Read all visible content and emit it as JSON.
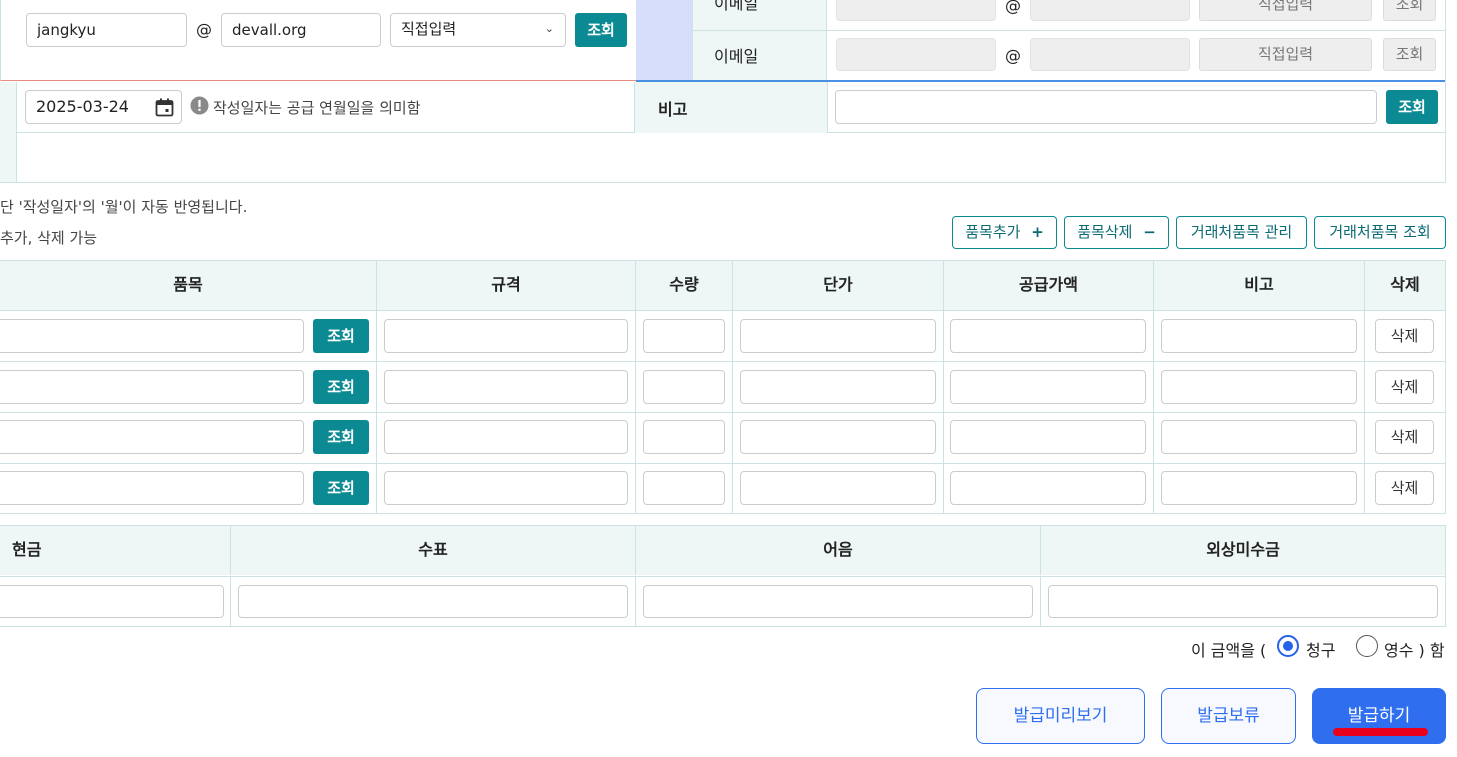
{
  "email_row1": {
    "id": "jangkyu",
    "at": "@",
    "domain": "devall.org",
    "domain_select": "직접입력",
    "lookup": "조회"
  },
  "email_right": {
    "label_top": "이메일",
    "label": "이메일",
    "at": "@",
    "select": "직접입력",
    "lookup": "조회"
  },
  "date_row": {
    "date": "2025-03-24",
    "notice": "작성일자는 공급 연월일을 의미함",
    "remark_label": "비고",
    "remark_value": "",
    "lookup": "조회"
  },
  "notes": {
    "line1": "단 '작성일자'의 '월'이 자동 반영됩니다.",
    "line2": "추가, 삭제 가능"
  },
  "item_actions": {
    "add": "품목추가",
    "remove": "품목삭제",
    "manage": "거래처품목 관리",
    "lookup": "거래처품목 조회"
  },
  "items_table": {
    "headers": [
      "품목",
      "규격",
      "수량",
      "단가",
      "공급가액",
      "비고",
      "삭제"
    ],
    "lookup_label": "조회",
    "delete_label": "삭제",
    "rows": [
      {
        "item": "",
        "spec": "",
        "qty": "",
        "price": "",
        "amount": "",
        "remark": ""
      },
      {
        "item": "",
        "spec": "",
        "qty": "",
        "price": "",
        "amount": "",
        "remark": ""
      },
      {
        "item": "",
        "spec": "",
        "qty": "",
        "price": "",
        "amount": "",
        "remark": ""
      },
      {
        "item": "",
        "spec": "",
        "qty": "",
        "price": "",
        "amount": "",
        "remark": ""
      }
    ]
  },
  "payment_table": {
    "headers": [
      "현금",
      "수표",
      "어음",
      "외상미수금"
    ],
    "values": [
      "",
      "",
      "",
      ""
    ]
  },
  "amount_claim": {
    "prefix": "이 금액을 (",
    "option_claim": "청구",
    "option_receipt": "영수 ) 함",
    "selected": "청구"
  },
  "footer": {
    "preview": "발급미리보기",
    "hold": "발급보류",
    "issue": "발급하기"
  },
  "colors": {
    "accent": "#0b8a93",
    "primary": "#2f6fef",
    "header_bg": "#eef7f6",
    "highlight": "#e8001c"
  }
}
